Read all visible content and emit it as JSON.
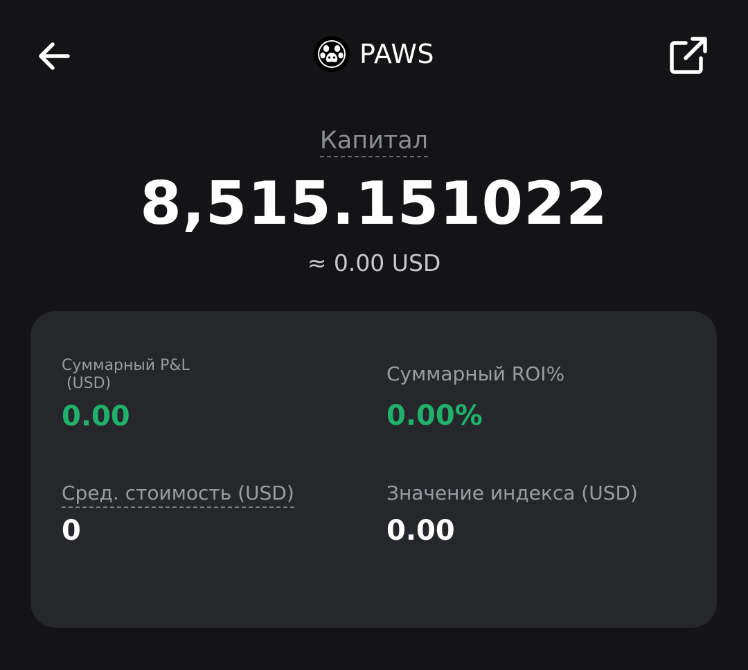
{
  "header": {
    "title": "PAWS",
    "back_icon": "arrow-left-icon",
    "share_icon": "external-link-icon",
    "logo_icon": "paw-logo-icon"
  },
  "capital": {
    "label": "Капитал",
    "value": "8,515.151022",
    "usd_equivalent": "≈ 0.00 USD"
  },
  "stats": {
    "total_pnl": {
      "label_line1": "Суммарный P&L",
      "label_line2": " (USD)",
      "value": "0.00"
    },
    "total_roi": {
      "label": "Суммарный ROI%",
      "value": "0.00%"
    },
    "avg_cost": {
      "label": "Сред. стоимость (USD)",
      "value": "0"
    },
    "index_value": {
      "label": "Значение индекса (USD)",
      "value": "0.00"
    }
  },
  "colors": {
    "background": "#141417",
    "card": "#25272b",
    "positive": "#20b26c",
    "muted_text": "#9a9da2"
  }
}
